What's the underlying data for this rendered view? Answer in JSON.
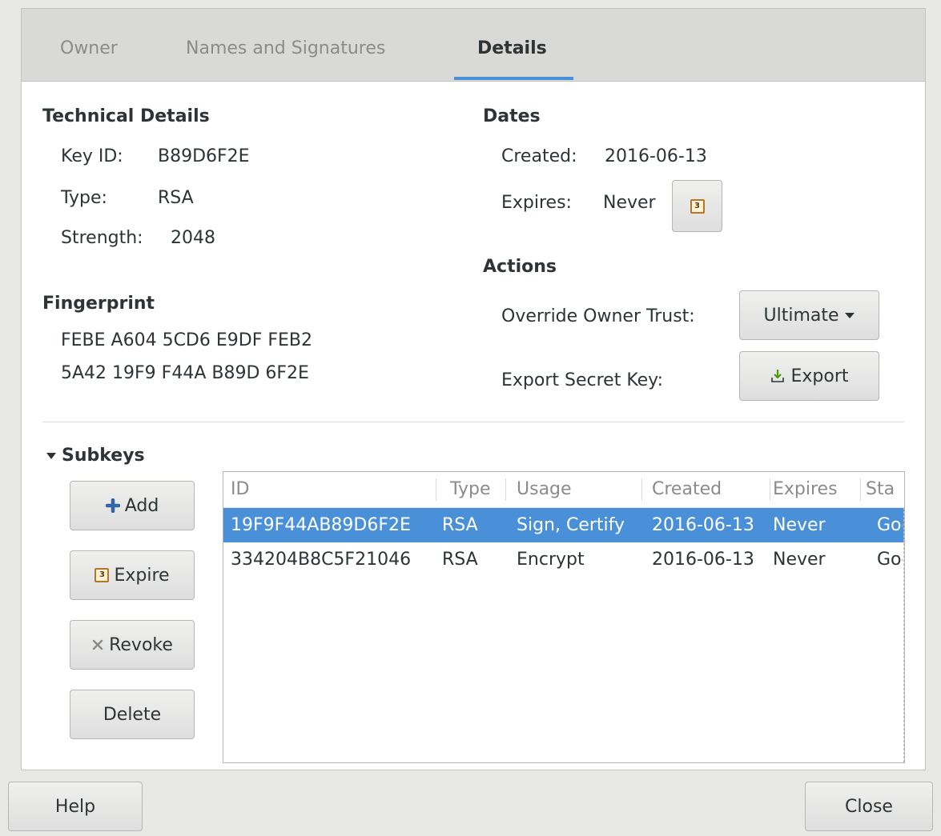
{
  "tabs": {
    "owner": "Owner",
    "names": "Names and Signatures",
    "details": "Details"
  },
  "technical": {
    "heading": "Technical Details",
    "key_id_label": "Key ID:",
    "key_id": "B89D6F2E",
    "type_label": "Type:",
    "type": "RSA",
    "strength_label": "Strength:",
    "strength": "2048"
  },
  "fingerprint": {
    "heading": "Fingerprint",
    "line1": "FEBE A604 5CD6 E9DF FEB2",
    "line2": "5A42 19F9 F44A B89D 6F2E"
  },
  "dates": {
    "heading": "Dates",
    "created_label": "Created:",
    "created": "2016-06-13",
    "expires_label": "Expires:",
    "expires": "Never",
    "calendar_glyph": "3"
  },
  "actions": {
    "heading": "Actions",
    "trust_label": "Override Owner Trust:",
    "trust_value": "Ultimate",
    "export_label": "Export Secret Key:",
    "export_button": "Export"
  },
  "subkeys": {
    "heading": "Subkeys",
    "add": "Add",
    "expire": "Expire",
    "revoke": "Revoke",
    "delete": "Delete",
    "columns": {
      "id": "ID",
      "type": "Type",
      "usage": "Usage",
      "created": "Created",
      "expires": "Expires",
      "status": "Sta"
    },
    "rows": [
      {
        "id": "19F9F44AB89D6F2E",
        "type": "RSA",
        "usage": "Sign, Certify",
        "created": "2016-06-13",
        "expires": "Never",
        "status": "Goo"
      },
      {
        "id": "334204B8C5F21046",
        "type": "RSA",
        "usage": "Encrypt",
        "created": "2016-06-13",
        "expires": "Never",
        "status": "Goo"
      }
    ]
  },
  "footer": {
    "help": "Help",
    "close": "Close"
  },
  "icons": {
    "add": "plus-icon",
    "calendar": "calendar-icon",
    "revoke": "x-icon",
    "export": "export-icon",
    "dropdown": "chevron-down-icon",
    "expander": "triangle-down-icon"
  },
  "colors": {
    "selection": "#4a90d9",
    "active_tab_underline": "#4a90d9"
  }
}
